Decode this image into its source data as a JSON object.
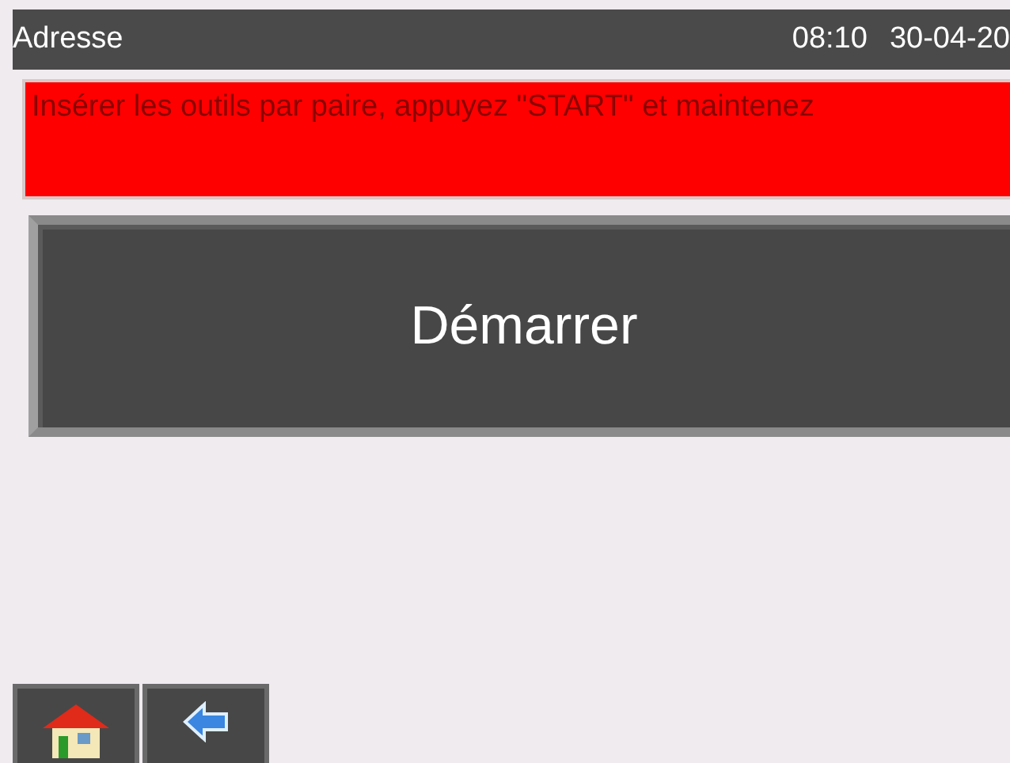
{
  "header": {
    "title": "Adresse",
    "time": "08:10",
    "date": "30-04-20"
  },
  "message": "Insérer les outils par paire, appuyez \"START\" et maintenez",
  "start_button": {
    "label": "Démarrer"
  },
  "footer_buttons": [
    {
      "kind": "home"
    },
    {
      "kind": "back"
    }
  ]
}
